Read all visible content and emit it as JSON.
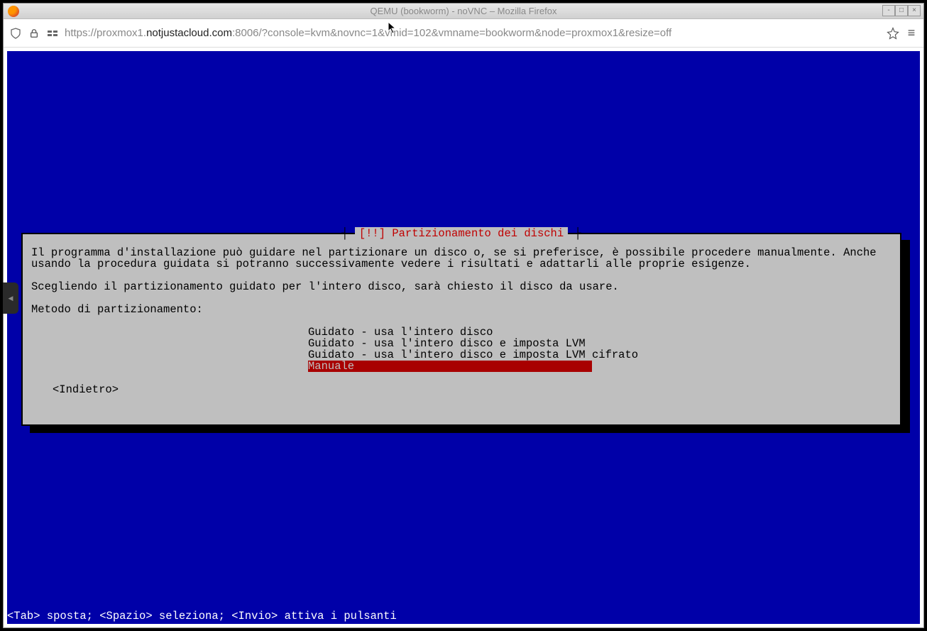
{
  "window": {
    "title": "QEMU (bookworm) - noVNC – Mozilla Firefox"
  },
  "addressbar": {
    "url_prefix": "https://proxmox1.",
    "url_domain": "notjustacloud.com",
    "url_suffix": ":8006/?console=kvm&novnc=1&vmid=102&vmname=bookworm&node=proxmox1&resize=off"
  },
  "installer": {
    "dialog_title": "[!!] Partizionamento dei dischi",
    "paragraph1": "Il programma d'installazione può guidare nel partizionare un disco o, se si preferisce, è possibile procedere manualmente. Anche usando la procedura guidata si potranno successivamente vedere i risultati e adattarli alle proprie esigenze.",
    "paragraph2": "Scegliendo il partizionamento guidato per l'intero disco, sarà chiesto il disco da usare.",
    "prompt": "Metodo di partizionamento:",
    "options": [
      "Guidato - usa l'intero disco",
      "Guidato - usa l'intero disco e imposta LVM",
      "Guidato - usa l'intero disco e imposta LVM cifrato",
      "Manuale"
    ],
    "selected_index": 3,
    "back_label": "<Indietro>",
    "footer": "<Tab> sposta; <Spazio> seleziona; <Invio> attiva i pulsanti"
  }
}
